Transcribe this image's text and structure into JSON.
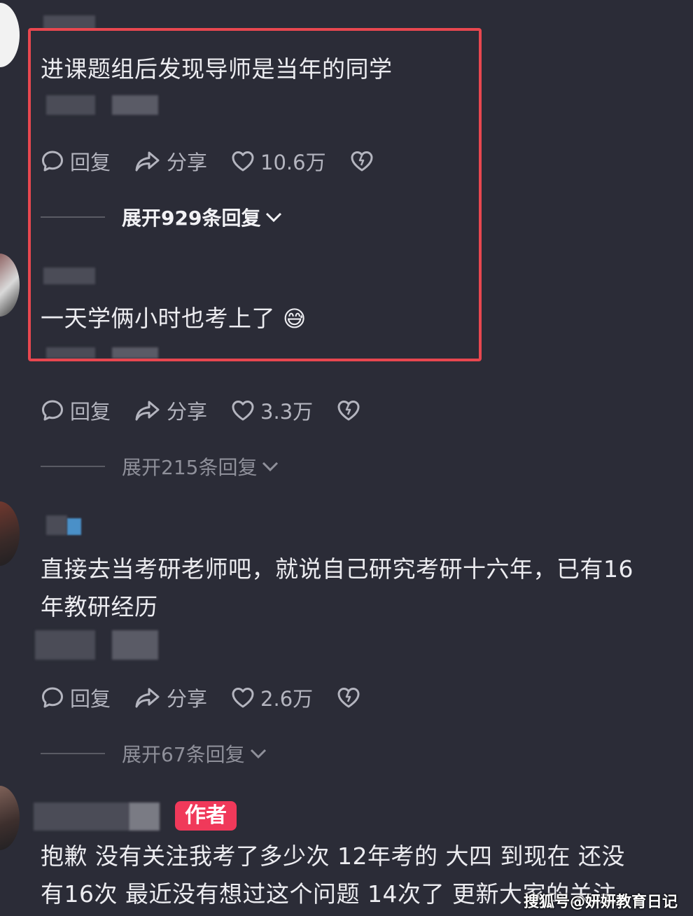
{
  "comments": [
    {
      "text": "进课题组后发现导师是当年的同学",
      "reply_label": "回复",
      "share_label": "分享",
      "likes": "10.6万",
      "expand_label": "展开929条回复"
    },
    {
      "text": "一天学俩小时也考上了",
      "emoji": "😅",
      "reply_label": "回复",
      "share_label": "分享",
      "likes": "3.3万",
      "expand_label": "展开215条回复"
    },
    {
      "text_line1": "直接去当考研老师吧，就说自己研究考研十六年，已有16",
      "text_line2": "年教研经历",
      "reply_label": "回复",
      "share_label": "分享",
      "likes": "2.6万",
      "expand_label": "展开67条回复"
    },
    {
      "badge": "作者",
      "text_line1": "抱歉 没有关注我考了多少次 12年考的 大四 到现在 还没",
      "text_line2": "有16次 最近没有想过这个问题 14次了 更新大家的关注"
    }
  ],
  "icons": [
    "comment-icon",
    "share-icon",
    "heart-icon",
    "broken-heart-icon",
    "chevron-down-icon"
  ],
  "watermark": "搜狐号@妍妍教育日记",
  "colors": {
    "background": "#2b2c37",
    "highlight": "#e8474f",
    "badge": "#f0395a"
  }
}
